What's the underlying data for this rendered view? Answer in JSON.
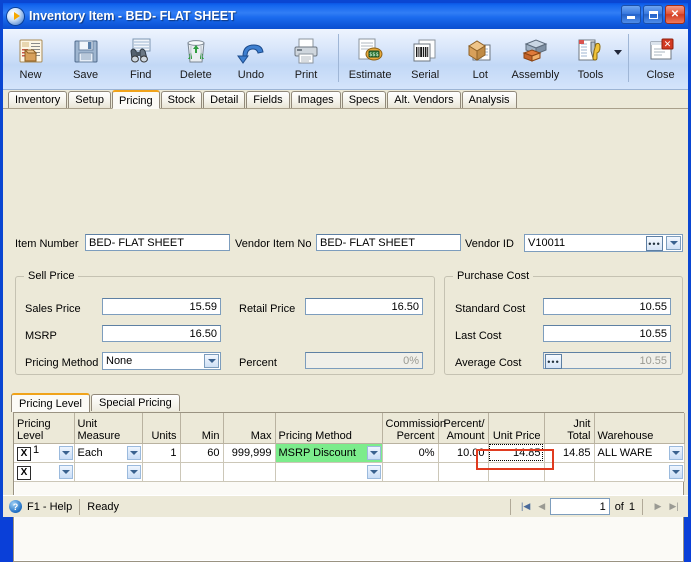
{
  "window": {
    "title_app": "Inventory Item",
    "title_sep": " - ",
    "title_doc": "BED- FLAT SHEET",
    "icon": "play-circle-icon",
    "buttons": {
      "minimize": "minimize",
      "maximize": "maximize",
      "close": "close"
    }
  },
  "toolbar": {
    "items": [
      {
        "label": "New",
        "icon": "new-item-icon"
      },
      {
        "label": "Save",
        "icon": "floppy-disk-icon"
      },
      {
        "label": "Find",
        "icon": "binoculars-icon"
      },
      {
        "label": "Delete",
        "icon": "trash-can-icon"
      },
      {
        "label": "Undo",
        "icon": "undo-arrow-icon"
      },
      {
        "label": "Print",
        "icon": "printer-icon"
      },
      {
        "label": "Estimate",
        "icon": "estimate-icon"
      },
      {
        "label": "Serial",
        "icon": "barcode-icon"
      },
      {
        "label": "Lot",
        "icon": "lot-box-icon"
      },
      {
        "label": "Assembly",
        "icon": "assembly-icon"
      },
      {
        "label": "Tools",
        "icon": "tools-wrench-icon"
      },
      {
        "label": "Close",
        "icon": "close-window-icon"
      }
    ]
  },
  "tabs": [
    {
      "label": "Inventory",
      "active": false
    },
    {
      "label": "Setup",
      "active": false
    },
    {
      "label": "Pricing",
      "active": true
    },
    {
      "label": "Stock",
      "active": false
    },
    {
      "label": "Detail",
      "active": false
    },
    {
      "label": "Fields",
      "active": false
    },
    {
      "label": "Images",
      "active": false
    },
    {
      "label": "Specs",
      "active": false
    },
    {
      "label": "Alt. Vendors",
      "active": false
    },
    {
      "label": "Analysis",
      "active": false
    }
  ],
  "header_fields": {
    "item_number_label": "Item Number",
    "item_number_value": "BED- FLAT SHEET",
    "vendor_item_no_label": "Vendor Item No",
    "vendor_item_no_value": "BED- FLAT SHEET",
    "vendor_id_label": "Vendor ID",
    "vendor_id_value": "V10011"
  },
  "sell_price": {
    "caption": "Sell Price",
    "sales_price_label": "Sales Price",
    "sales_price_value": "15.59",
    "retail_price_label": "Retail Price",
    "retail_price_value": "16.50",
    "msrp_label": "MSRP",
    "msrp_value": "16.50",
    "pricing_method_label": "Pricing Method",
    "pricing_method_value": "None",
    "percent_label": "Percent",
    "percent_value": "0%"
  },
  "purchase_cost": {
    "caption": "Purchase Cost",
    "standard_cost_label": "Standard Cost",
    "standard_cost_value": "10.55",
    "last_cost_label": "Last Cost",
    "last_cost_value": "10.55",
    "average_cost_label": "Average Cost",
    "average_cost_value": "10.55"
  },
  "grid_tabs": [
    {
      "label": "Pricing Level",
      "active": true
    },
    {
      "label": "Special Pricing",
      "active": false
    }
  ],
  "grid": {
    "columns": [
      "Pricing Level",
      "Unit Measure",
      "Units",
      "Min",
      "Max",
      "Pricing Method",
      "Commission Percent",
      "Percent/ Amount",
      "Unit Price",
      "Jnit Total",
      "Warehouse"
    ],
    "rows": [
      {
        "delete": "X",
        "pricing_level": "1",
        "unit_measure": "Each",
        "units": "1",
        "min": "60",
        "max": "999,999",
        "pricing_method": "MSRP Discount",
        "commission_percent": "0%",
        "percent_amount": "10.00",
        "unit_price": "14.85",
        "unit_total": "14.85",
        "warehouse": "ALL WARE"
      },
      {
        "delete": "X",
        "pricing_level": "",
        "unit_measure": "",
        "units": "",
        "min": "",
        "max": "",
        "pricing_method": "",
        "commission_percent": "",
        "percent_amount": "",
        "unit_price": "",
        "unit_total": "",
        "warehouse": ""
      }
    ]
  },
  "status": {
    "help": "F1 - Help",
    "message": "Ready",
    "page_value": "1",
    "of_label": "of",
    "page_total": "1"
  },
  "colors": {
    "title_blue": "#1265ee",
    "highlight_green": "#7cec8c",
    "annotation_red": "#e03b20",
    "active_tab_orange": "#f0a31a",
    "form_bg": "#ece9d8"
  }
}
